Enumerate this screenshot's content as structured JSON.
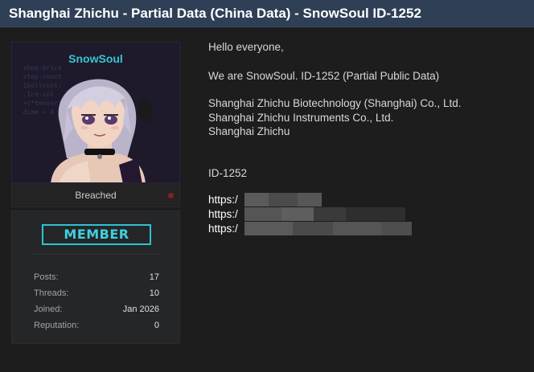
{
  "thread": {
    "title": "Shanghai Zhichu - Partial Data (China Data) - SnowSoul ID-1252"
  },
  "user": {
    "username": "SnowSoul",
    "status": "Breached",
    "rank_badge": "MEMBER",
    "stats": [
      {
        "label": "Posts:",
        "value": "17"
      },
      {
        "label": "Threads:",
        "value": "10"
      },
      {
        "label": "Joined:",
        "value": "Jan 2026"
      },
      {
        "label": "Reputation:",
        "value": "0"
      }
    ],
    "colors": {
      "username": "#36c5cf",
      "badge": "#2fc2d1",
      "status_dot": "#8a1f1f"
    }
  },
  "post": {
    "greeting": "Hello everyone,",
    "intro": "We are SnowSoul. ID-1252 (Partial Public Data)",
    "companies": [
      "Shanghai Zhichu Biotechnology (Shanghai) Co., Ltd.",
      "Shanghai Zhichu Instruments Co., Ltd.",
      "Shanghai Zhichu"
    ],
    "id_label": "ID-1252",
    "links": [
      "https:/",
      "https:/",
      "https:/"
    ]
  }
}
